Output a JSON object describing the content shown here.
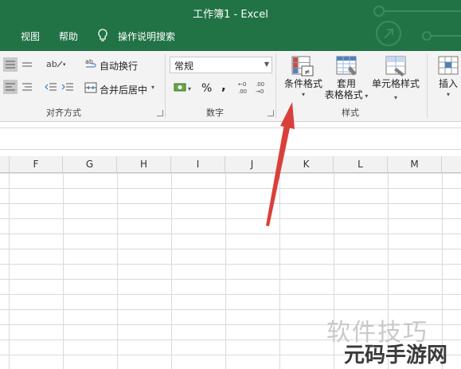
{
  "window": {
    "title": "工作簿1  -  Excel"
  },
  "menubar": {
    "items": [
      "视图",
      "帮助",
      "操作说明搜索"
    ]
  },
  "ribbon": {
    "alignment": {
      "wrap_text": "自动换行",
      "merge_center": "合并后居中",
      "group_label": "对齐方式"
    },
    "number": {
      "format_value": "常规",
      "percent": "%",
      "comma": ",",
      "group_label": "数字"
    },
    "styles": {
      "conditional_formatting": "条件格式",
      "format_as_table_line1": "套用",
      "format_as_table_line2": "表格格式",
      "cell_styles": "单元格样式",
      "group_label": "样式"
    },
    "cells": {
      "insert": "插入"
    }
  },
  "columns": [
    "F",
    "G",
    "H",
    "I",
    "J",
    "K",
    "L",
    "M"
  ],
  "watermark": {
    "line1": "软件技巧",
    "line2": "元码手游网"
  },
  "colors": {
    "excel_green": "#217346",
    "annotation_arrow": "#d9403a"
  }
}
